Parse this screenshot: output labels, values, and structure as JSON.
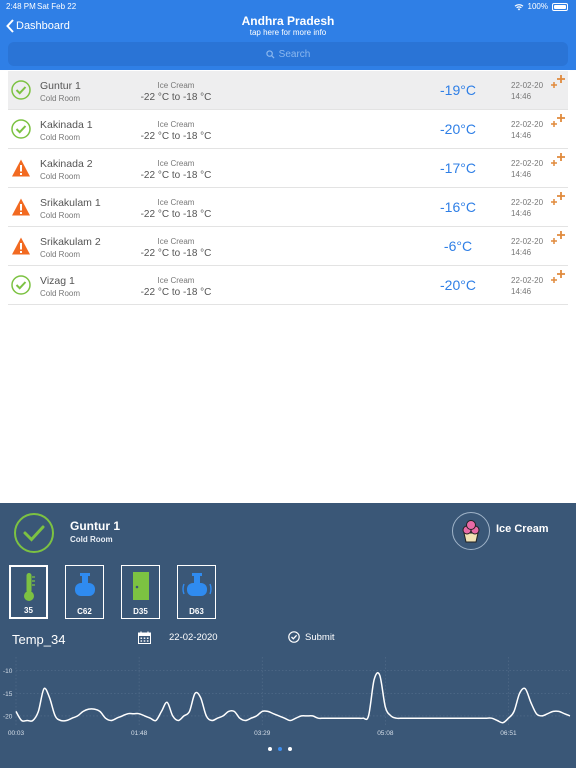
{
  "status": {
    "time": "2:48 PM",
    "date": "Sat Feb 22",
    "battery": "100%"
  },
  "header": {
    "back_label": "Dashboard",
    "title": "Andhra Pradesh",
    "subtitle": "tap here for more info",
    "search_placeholder": "Search"
  },
  "rows": [
    {
      "name": "Guntur 1",
      "type": "Cold Room",
      "product": "Ice Cream",
      "range": "-22 °C to -18 °C",
      "temp": "-19°C",
      "date": "22-02-20",
      "time": "14:46",
      "status": "ok",
      "selected": true
    },
    {
      "name": "Kakinada 1",
      "type": "Cold Room",
      "product": "Ice Cream",
      "range": "-22 °C to -18 °C",
      "temp": "-20°C",
      "date": "22-02-20",
      "time": "14:46",
      "status": "ok",
      "selected": false
    },
    {
      "name": "Kakinada 2",
      "type": "Cold Room",
      "product": "Ice Cream",
      "range": "-22 °C to -18 °C",
      "temp": "-17°C",
      "date": "22-02-20",
      "time": "14:46",
      "status": "warning",
      "selected": false
    },
    {
      "name": "Srikakulam 1",
      "type": "Cold Room",
      "product": "Ice Cream",
      "range": "-22 °C to -18 °C",
      "temp": "-16°C",
      "date": "22-02-20",
      "time": "14:46",
      "status": "warning",
      "selected": false
    },
    {
      "name": "Srikakulam 2",
      "type": "Cold Room",
      "product": "Ice Cream",
      "range": "-22 °C to -18 °C",
      "temp": "-6°C",
      "date": "22-02-20",
      "time": "14:46",
      "status": "warning",
      "selected": false
    },
    {
      "name": "Vizag 1",
      "type": "Cold Room",
      "product": "Ice Cream",
      "range": "-22 °C to -18 °C",
      "temp": "-20°C",
      "date": "22-02-20",
      "time": "14:46",
      "status": "ok",
      "selected": false
    }
  ],
  "detail": {
    "name": "Guntur 1",
    "type": "Cold Room",
    "product": "Ice Cream",
    "sensors": [
      {
        "label": "35",
        "icon": "thermometer-icon",
        "active": true
      },
      {
        "label": "C62",
        "icon": "compressor-icon",
        "active": false
      },
      {
        "label": "D35",
        "icon": "door-icon",
        "active": false
      },
      {
        "label": "D63",
        "icon": "compressor-signal-icon",
        "active": false
      }
    ],
    "chart_title": "Temp_34",
    "date": "22-02-2020",
    "submit_label": "Submit"
  },
  "colors": {
    "header": "#2f7fe6",
    "panel": "#3a5777",
    "ok": "#7cc242",
    "warning": "#f26a21",
    "temp": "#2f7fe6",
    "add": "#e08a3c"
  },
  "chart_data": {
    "type": "line",
    "title": "Temp_34",
    "ylim": [
      -22,
      -7
    ],
    "y_ticks": [
      -10,
      -15,
      -20
    ],
    "x_tick_labels": [
      "00:03",
      "01:48",
      "03:29",
      "05:08",
      "06:51"
    ],
    "x_tick_positions": [
      0,
      22,
      44,
      66,
      88
    ],
    "grid": true,
    "series": [
      {
        "x": [
          0,
          1,
          2,
          3,
          4,
          5,
          6,
          7,
          8,
          9,
          10,
          11,
          12,
          13,
          14,
          15,
          16,
          17,
          18,
          19,
          20,
          21,
          22,
          23,
          24,
          25,
          26,
          27,
          28,
          29,
          30,
          31,
          32,
          33,
          34,
          35,
          36,
          37,
          38,
          39,
          40,
          41,
          42,
          43,
          44,
          45,
          46,
          47,
          48,
          49,
          50,
          51,
          52,
          53,
          54,
          55,
          56,
          57,
          58,
          59,
          60,
          61,
          62,
          63,
          64,
          65,
          66,
          67,
          68,
          69,
          70,
          71,
          72,
          73,
          74,
          75,
          76,
          77,
          78,
          79,
          80,
          81,
          82,
          83,
          84,
          85,
          86,
          87,
          88,
          89,
          90,
          91,
          92,
          93,
          94,
          95,
          96,
          97,
          98,
          99
        ],
        "y": [
          -19,
          -21,
          -21,
          -21,
          -19,
          -14,
          -16,
          -20,
          -21,
          -21,
          -20.5,
          -20,
          -19,
          -18.5,
          -18.5,
          -19,
          -20.5,
          -21,
          -20.5,
          -20,
          -19.5,
          -19.5,
          -19.5,
          -20,
          -20.5,
          -21,
          -19,
          -17,
          -20,
          -21,
          -20,
          -19,
          -15,
          -16,
          -20,
          -21,
          -20.5,
          -20,
          -19,
          -19,
          -20.5,
          -21,
          -20.5,
          -20,
          -19,
          -19,
          -19.5,
          -20,
          -20.5,
          -21,
          -20.5,
          -20,
          -20,
          -20,
          -20.5,
          -20.5,
          -20.5,
          -20.5,
          -20.5,
          -20.5,
          -20.5,
          -20.5,
          -20.5,
          -20,
          -12,
          -11,
          -18,
          -20,
          -20.5,
          -20.5,
          -20.5,
          -20.5,
          -20.5,
          -20.5,
          -20.5,
          -20.5,
          -20.5,
          -20.5,
          -20.5,
          -20.5,
          -20.5,
          -20.5,
          -20.5,
          -20.5,
          -20.5,
          -20.5,
          -21,
          -21.5,
          -20.5,
          -19,
          -15,
          -14,
          -17,
          -19.5,
          -20,
          -19.5,
          -19,
          -19,
          -19.5,
          -20
        ]
      }
    ]
  }
}
